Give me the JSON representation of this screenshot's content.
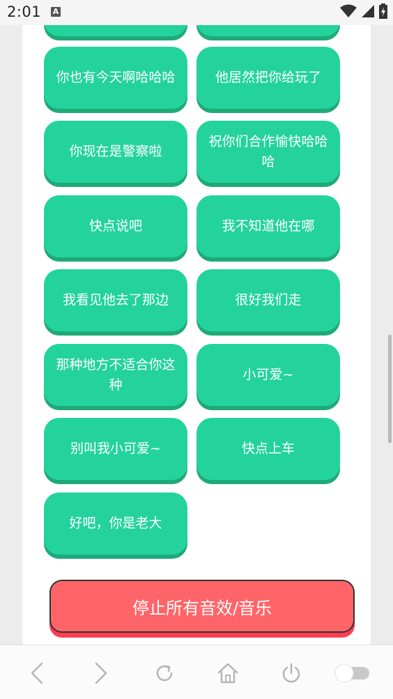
{
  "status_bar": {
    "time": "2:01",
    "notification_letter": "A"
  },
  "buttons": [
    {
      "label": "你也有今天啊哈哈哈"
    },
    {
      "label": "他居然把你给玩了"
    },
    {
      "label": "你现在是警察啦"
    },
    {
      "label": "祝你们合作愉快哈哈哈"
    },
    {
      "label": "快点说吧"
    },
    {
      "label": "我不知道他在哪"
    },
    {
      "label": "我看见他去了那边"
    },
    {
      "label": "很好我们走"
    },
    {
      "label": "那种地方不适合你这种"
    },
    {
      "label": "小可爱~"
    },
    {
      "label": "别叫我小可爱~"
    },
    {
      "label": "快点上车"
    },
    {
      "label": "好吧，你是老大"
    }
  ],
  "stop_button": {
    "label": "停止所有音效/音乐"
  },
  "colors": {
    "button_green": "#23d39b",
    "stop_red": "#ff6568"
  }
}
